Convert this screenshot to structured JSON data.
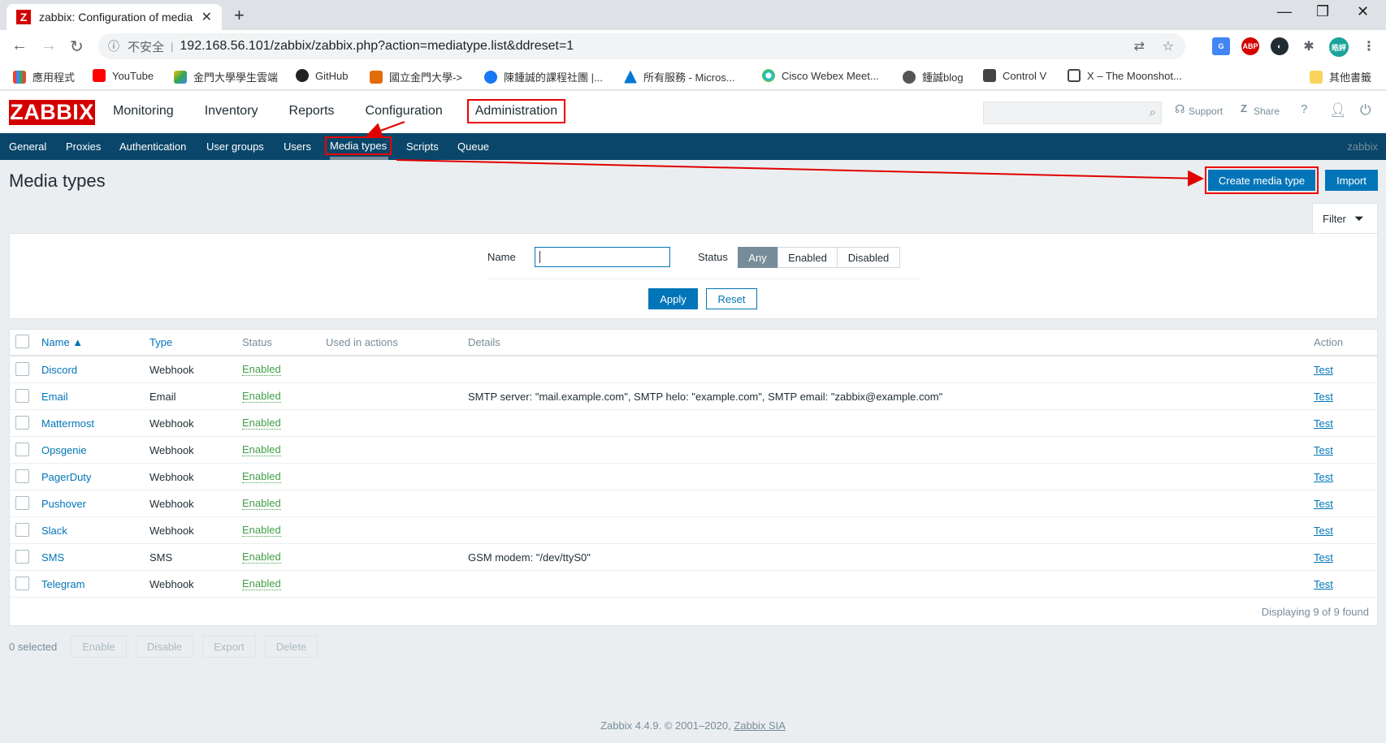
{
  "browser": {
    "tab_title": "zabbix: Configuration of media",
    "tab_favicon": "Z",
    "insecure_label": "不安全",
    "url": "192.168.56.101/zabbix/zabbix.php?action=mediatype.list&ddreset=1",
    "bookmarks": [
      "應用程式",
      "YouTube",
      "金門大學學生雲端",
      "GitHub",
      "國立金門大學->",
      "陳鍾誠的課程社團 |...",
      "所有服務 - Micros...",
      "Cisco Webex Meet...",
      "鍾誠blog",
      "Control V",
      "X – The Moonshot..."
    ],
    "other_bookmarks": "其他書籤",
    "profile_label": "皓評"
  },
  "zabbix": {
    "logo": "ZABBIX",
    "top_menu": [
      "Monitoring",
      "Inventory",
      "Reports",
      "Configuration",
      "Administration"
    ],
    "support": "Support",
    "share": "Share",
    "help": "?",
    "sub_menu": [
      "General",
      "Proxies",
      "Authentication",
      "User groups",
      "Users",
      "Media types",
      "Scripts",
      "Queue"
    ],
    "server_name": "zabbix"
  },
  "page": {
    "title": "Media types",
    "create_button": "Create media type",
    "import_button": "Import"
  },
  "filter": {
    "tab_label": "Filter",
    "name_label": "Name",
    "name_value": "",
    "status_label": "Status",
    "status_options": [
      "Any",
      "Enabled",
      "Disabled"
    ],
    "status_selected": "Any",
    "apply": "Apply",
    "reset": "Reset"
  },
  "table": {
    "columns": [
      "Name ▲",
      "Type",
      "Status",
      "Used in actions",
      "Details",
      "Action"
    ],
    "rows": [
      {
        "name": "Discord",
        "type": "Webhook",
        "status": "Enabled",
        "used": "",
        "details": "",
        "action": "Test"
      },
      {
        "name": "Email",
        "type": "Email",
        "status": "Enabled",
        "used": "",
        "details": "SMTP server: \"mail.example.com\", SMTP helo: \"example.com\", SMTP email: \"zabbix@example.com\"",
        "action": "Test"
      },
      {
        "name": "Mattermost",
        "type": "Webhook",
        "status": "Enabled",
        "used": "",
        "details": "",
        "action": "Test"
      },
      {
        "name": "Opsgenie",
        "type": "Webhook",
        "status": "Enabled",
        "used": "",
        "details": "",
        "action": "Test"
      },
      {
        "name": "PagerDuty",
        "type": "Webhook",
        "status": "Enabled",
        "used": "",
        "details": "",
        "action": "Test"
      },
      {
        "name": "Pushover",
        "type": "Webhook",
        "status": "Enabled",
        "used": "",
        "details": "",
        "action": "Test"
      },
      {
        "name": "Slack",
        "type": "Webhook",
        "status": "Enabled",
        "used": "",
        "details": "",
        "action": "Test"
      },
      {
        "name": "SMS",
        "type": "SMS",
        "status": "Enabled",
        "used": "",
        "details": "GSM modem: \"/dev/ttyS0\"",
        "action": "Test"
      },
      {
        "name": "Telegram",
        "type": "Webhook",
        "status": "Enabled",
        "used": "",
        "details": "",
        "action": "Test"
      }
    ],
    "count_text": "Displaying 9 of 9 found"
  },
  "mass_actions": {
    "selected_text": "0 selected",
    "buttons": [
      "Enable",
      "Disable",
      "Export",
      "Delete"
    ]
  },
  "footer": {
    "text": "Zabbix 4.4.9. © 2001–2020,",
    "link": "Zabbix SIA"
  },
  "colors": {
    "brand_red": "#d40000",
    "nav_blue": "#0a466a",
    "button_blue": "#0275b8",
    "enabled_green": "#429e47",
    "annotation_red": "#e00000"
  }
}
